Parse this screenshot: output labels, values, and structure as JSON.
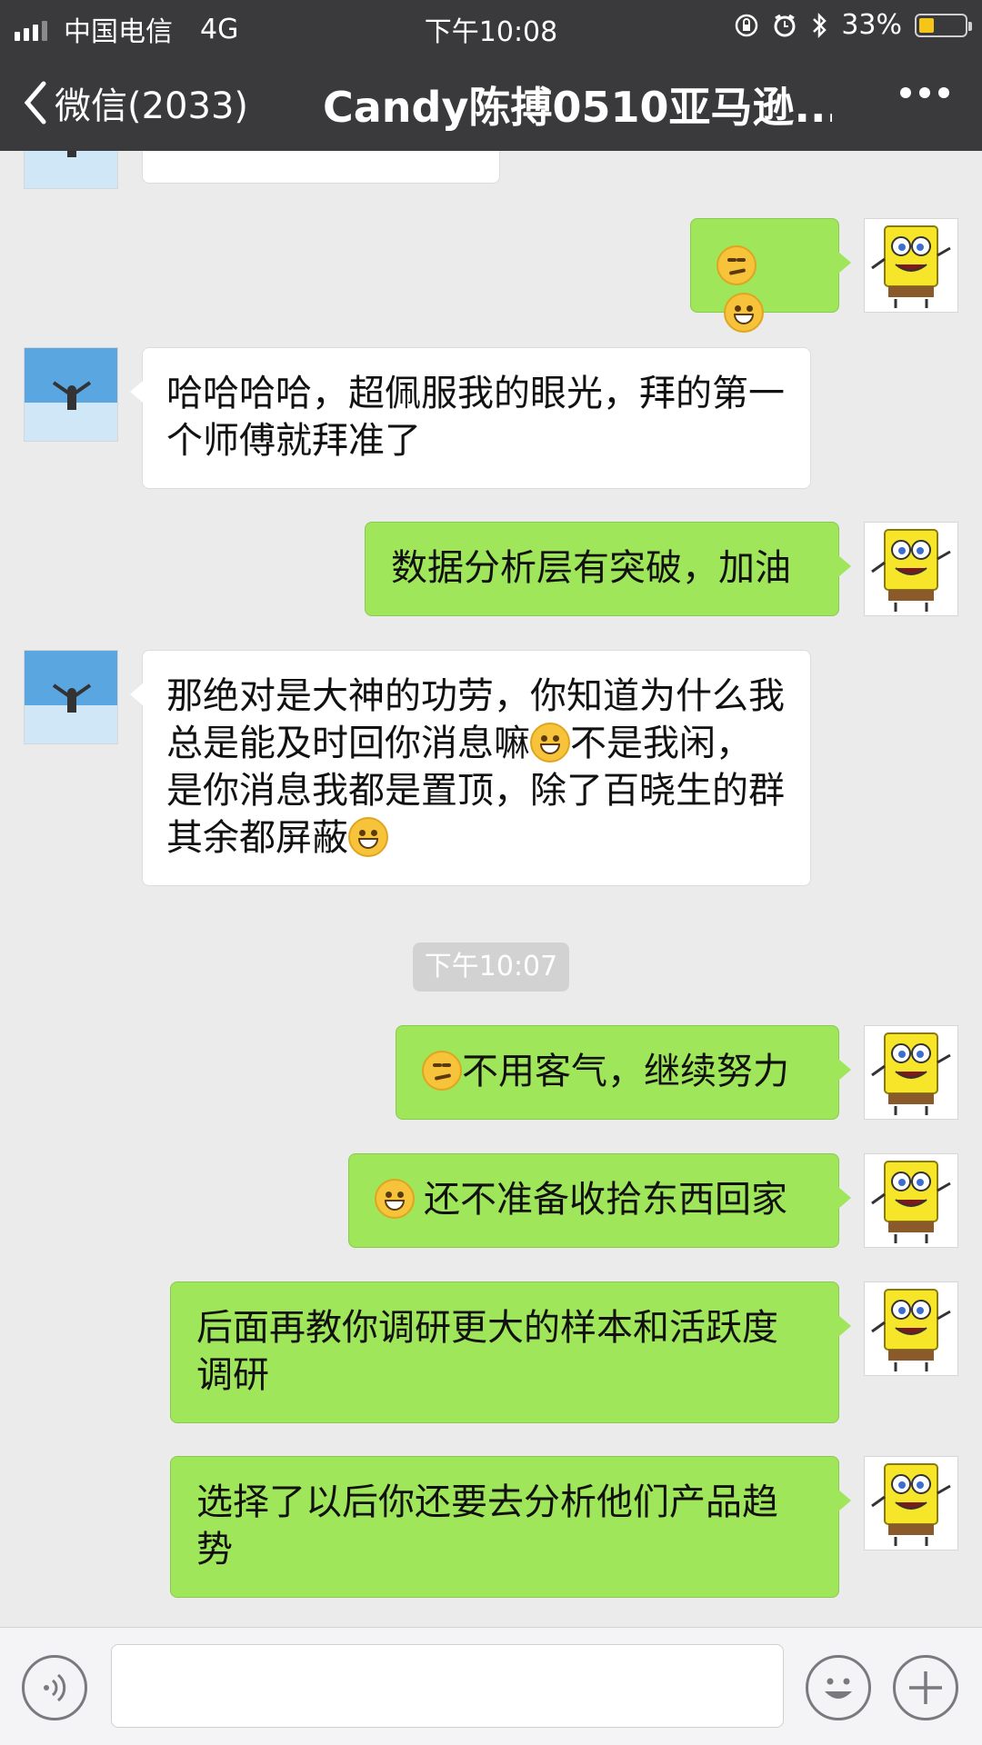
{
  "status_bar": {
    "carrier": "中国电信",
    "network": "4G",
    "time": "下午10:08",
    "battery_percent": "33%",
    "battery_level": 0.33,
    "battery_color": "#f5c518"
  },
  "nav": {
    "back_label": "微信(2033)",
    "title": "Candy陈搏0510亚马逊...",
    "more_icon": "more-dots-icon"
  },
  "messages": [
    {
      "side": "them",
      "text": ""
    },
    {
      "side": "me",
      "text": "",
      "emojis": [
        "smirk",
        "grin"
      ]
    },
    {
      "side": "them",
      "text": "哈哈哈哈，超佩服我的眼光，拜的第一个师傅就拜准了"
    },
    {
      "side": "me",
      "text": "数据分析层有突破，加油"
    },
    {
      "side": "them",
      "text_a": "那绝对是大神的功劳，你知道为什么我总是能及时回你消息嘛",
      "text_b": "不是我闲，是你消息我都是置顶，除了百晓生的群其余都屏蔽"
    },
    {
      "side": "me",
      "text": "不用客气，继续努力"
    },
    {
      "side": "me",
      "text": "还不准备收拾东西回家"
    },
    {
      "side": "me",
      "text": "后面再教你调研更大的样本和活跃度调研"
    },
    {
      "side": "me",
      "text": "选择了以后你还要去分析他们产品趋势"
    }
  ],
  "timestamp": "下午10:07",
  "input_bar": {
    "voice_icon": "voice-icon",
    "emoji_icon": "emoji-icon",
    "plus_icon": "plus-icon"
  },
  "colors": {
    "bar": "#3a3a3c",
    "my_bubble": "#9fe65a",
    "their_bubble": "#ffffff",
    "background": "#ebebeb"
  }
}
